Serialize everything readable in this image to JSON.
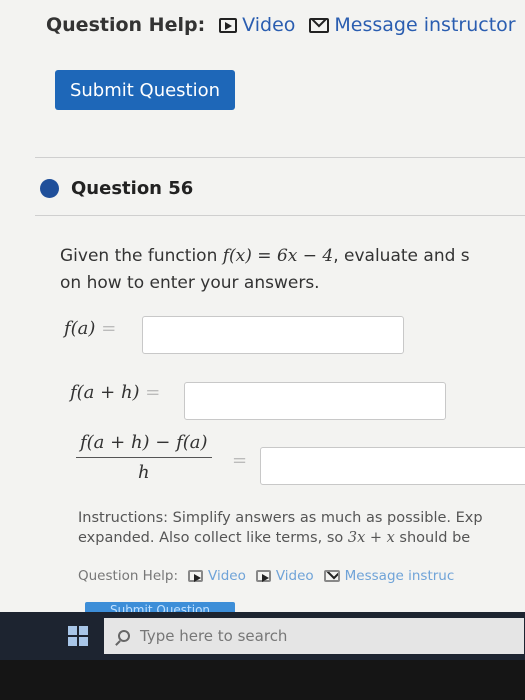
{
  "help_top": {
    "label": "Question Help:",
    "video": "Video",
    "message": "Message instructor"
  },
  "submit_label": "Submit Question",
  "question": {
    "title": "Question 56",
    "prompt_pre": "Given the function ",
    "function": "f(x) = 6x − 4",
    "prompt_post": ", evaluate and s",
    "prompt_line2": "on how to enter your answers."
  },
  "rows": {
    "fa_label": "f(a)",
    "fah_label": "f(a + h)",
    "frac_num": "f(a + h) − f(a)",
    "frac_den": "h",
    "equals": "="
  },
  "instructions": {
    "line1": "Instructions: Simplify answers as much as possible. Exp",
    "line2_pre": "expanded. Also collect like terms, so ",
    "line2_math": "3x + x",
    "line2_post": " should be"
  },
  "help_bottom": {
    "label": "Question Help:",
    "video1": "Video",
    "video2": "Video",
    "message": "Message instruc"
  },
  "submit2_label": "Submit Question",
  "taskbar": {
    "search_placeholder": "Type here to search"
  }
}
